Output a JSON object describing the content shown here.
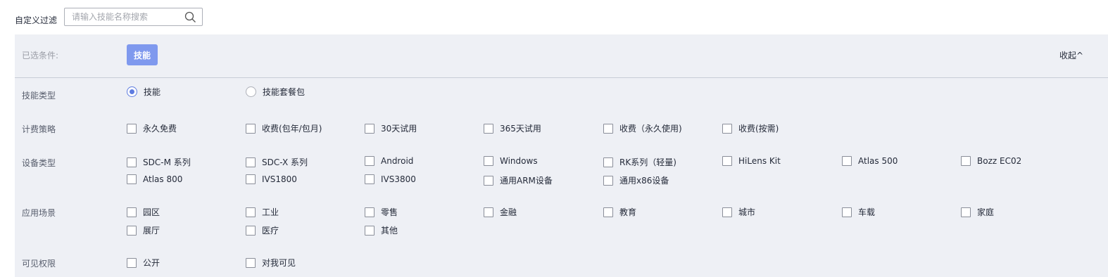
{
  "filter": {
    "label": "自定义过滤",
    "search_placeholder": "请输入技能名称搜索"
  },
  "selected": {
    "label": "已选条件:",
    "tags": [
      "技能"
    ],
    "collapse_label": "收起^"
  },
  "rows": {
    "skill_type": {
      "label": "技能类型",
      "options": [
        "技能",
        "技能套餐包"
      ],
      "selected": "技能"
    },
    "billing": {
      "label": "计费策略",
      "options": [
        "永久免费",
        "收费(包年/包月)",
        "30天试用",
        "365天试用",
        "收费（永久使用)",
        "收费(按需)"
      ]
    },
    "device": {
      "label": "设备类型",
      "options": [
        "SDC-M 系列",
        "SDC-X 系列",
        "Android",
        "Windows",
        "RK系列（轻量)",
        "HiLens Kit",
        "Atlas 500",
        "Bozz EC02",
        "Atlas 800",
        "IVS1800",
        "IVS3800",
        "通用ARM设备",
        "通用x86设备"
      ]
    },
    "scene": {
      "label": "应用场景",
      "options": [
        "园区",
        "工业",
        "零售",
        "金融",
        "教育",
        "城市",
        "车载",
        "家庭",
        "展厅",
        "医疗",
        "其他"
      ]
    },
    "visibility": {
      "label": "可见权限",
      "options": [
        "公开",
        "对我可见"
      ]
    }
  },
  "colors": {
    "accent": "#5e7ce0",
    "tag_bg": "#7f99ee",
    "panel_bg": "#eef0f5"
  }
}
